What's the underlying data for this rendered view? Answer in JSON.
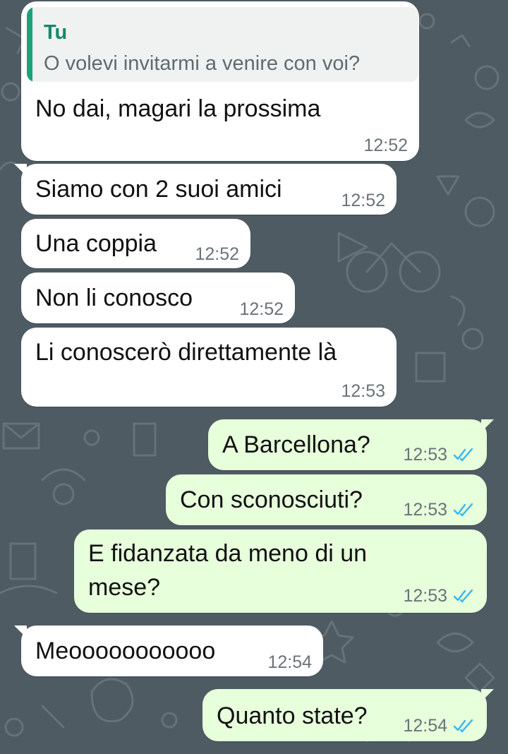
{
  "colors": {
    "wallpaper": "#4f5b63",
    "incoming_bubble": "#ffffff",
    "outgoing_bubble": "#e7ffdb",
    "quote_accent": "#1aa37a",
    "read_ticks": "#34b7f1"
  },
  "messages": [
    {
      "direction": "in",
      "quote": {
        "author": "Tu",
        "text": "O volevi invitarmi a venire con voi?"
      },
      "text": "No dai, magari la prossima",
      "time": "12:52"
    },
    {
      "direction": "in",
      "text": "Siamo con 2 suoi amici",
      "time": "12:52"
    },
    {
      "direction": "in",
      "text": "Una coppia",
      "time": "12:52"
    },
    {
      "direction": "in",
      "text": "Non li conosco",
      "time": "12:52"
    },
    {
      "direction": "in",
      "text": "Li conoscerò direttamente là",
      "time": "12:53"
    },
    {
      "direction": "out",
      "text": "A Barcellona?",
      "time": "12:53",
      "status": "read-ticks-icon"
    },
    {
      "direction": "out",
      "text": "Con sconosciuti?",
      "time": "12:53",
      "status": "read-ticks-icon"
    },
    {
      "direction": "out",
      "text_lines": [
        "E fidanzata da meno di un",
        "mese?"
      ],
      "time": "12:53",
      "status": "read-ticks-icon"
    },
    {
      "direction": "in",
      "text": "Meooooooooooo",
      "time": "12:54"
    },
    {
      "direction": "out",
      "text": "Quanto state?",
      "time": "12:54",
      "status": "read-ticks-icon"
    }
  ]
}
